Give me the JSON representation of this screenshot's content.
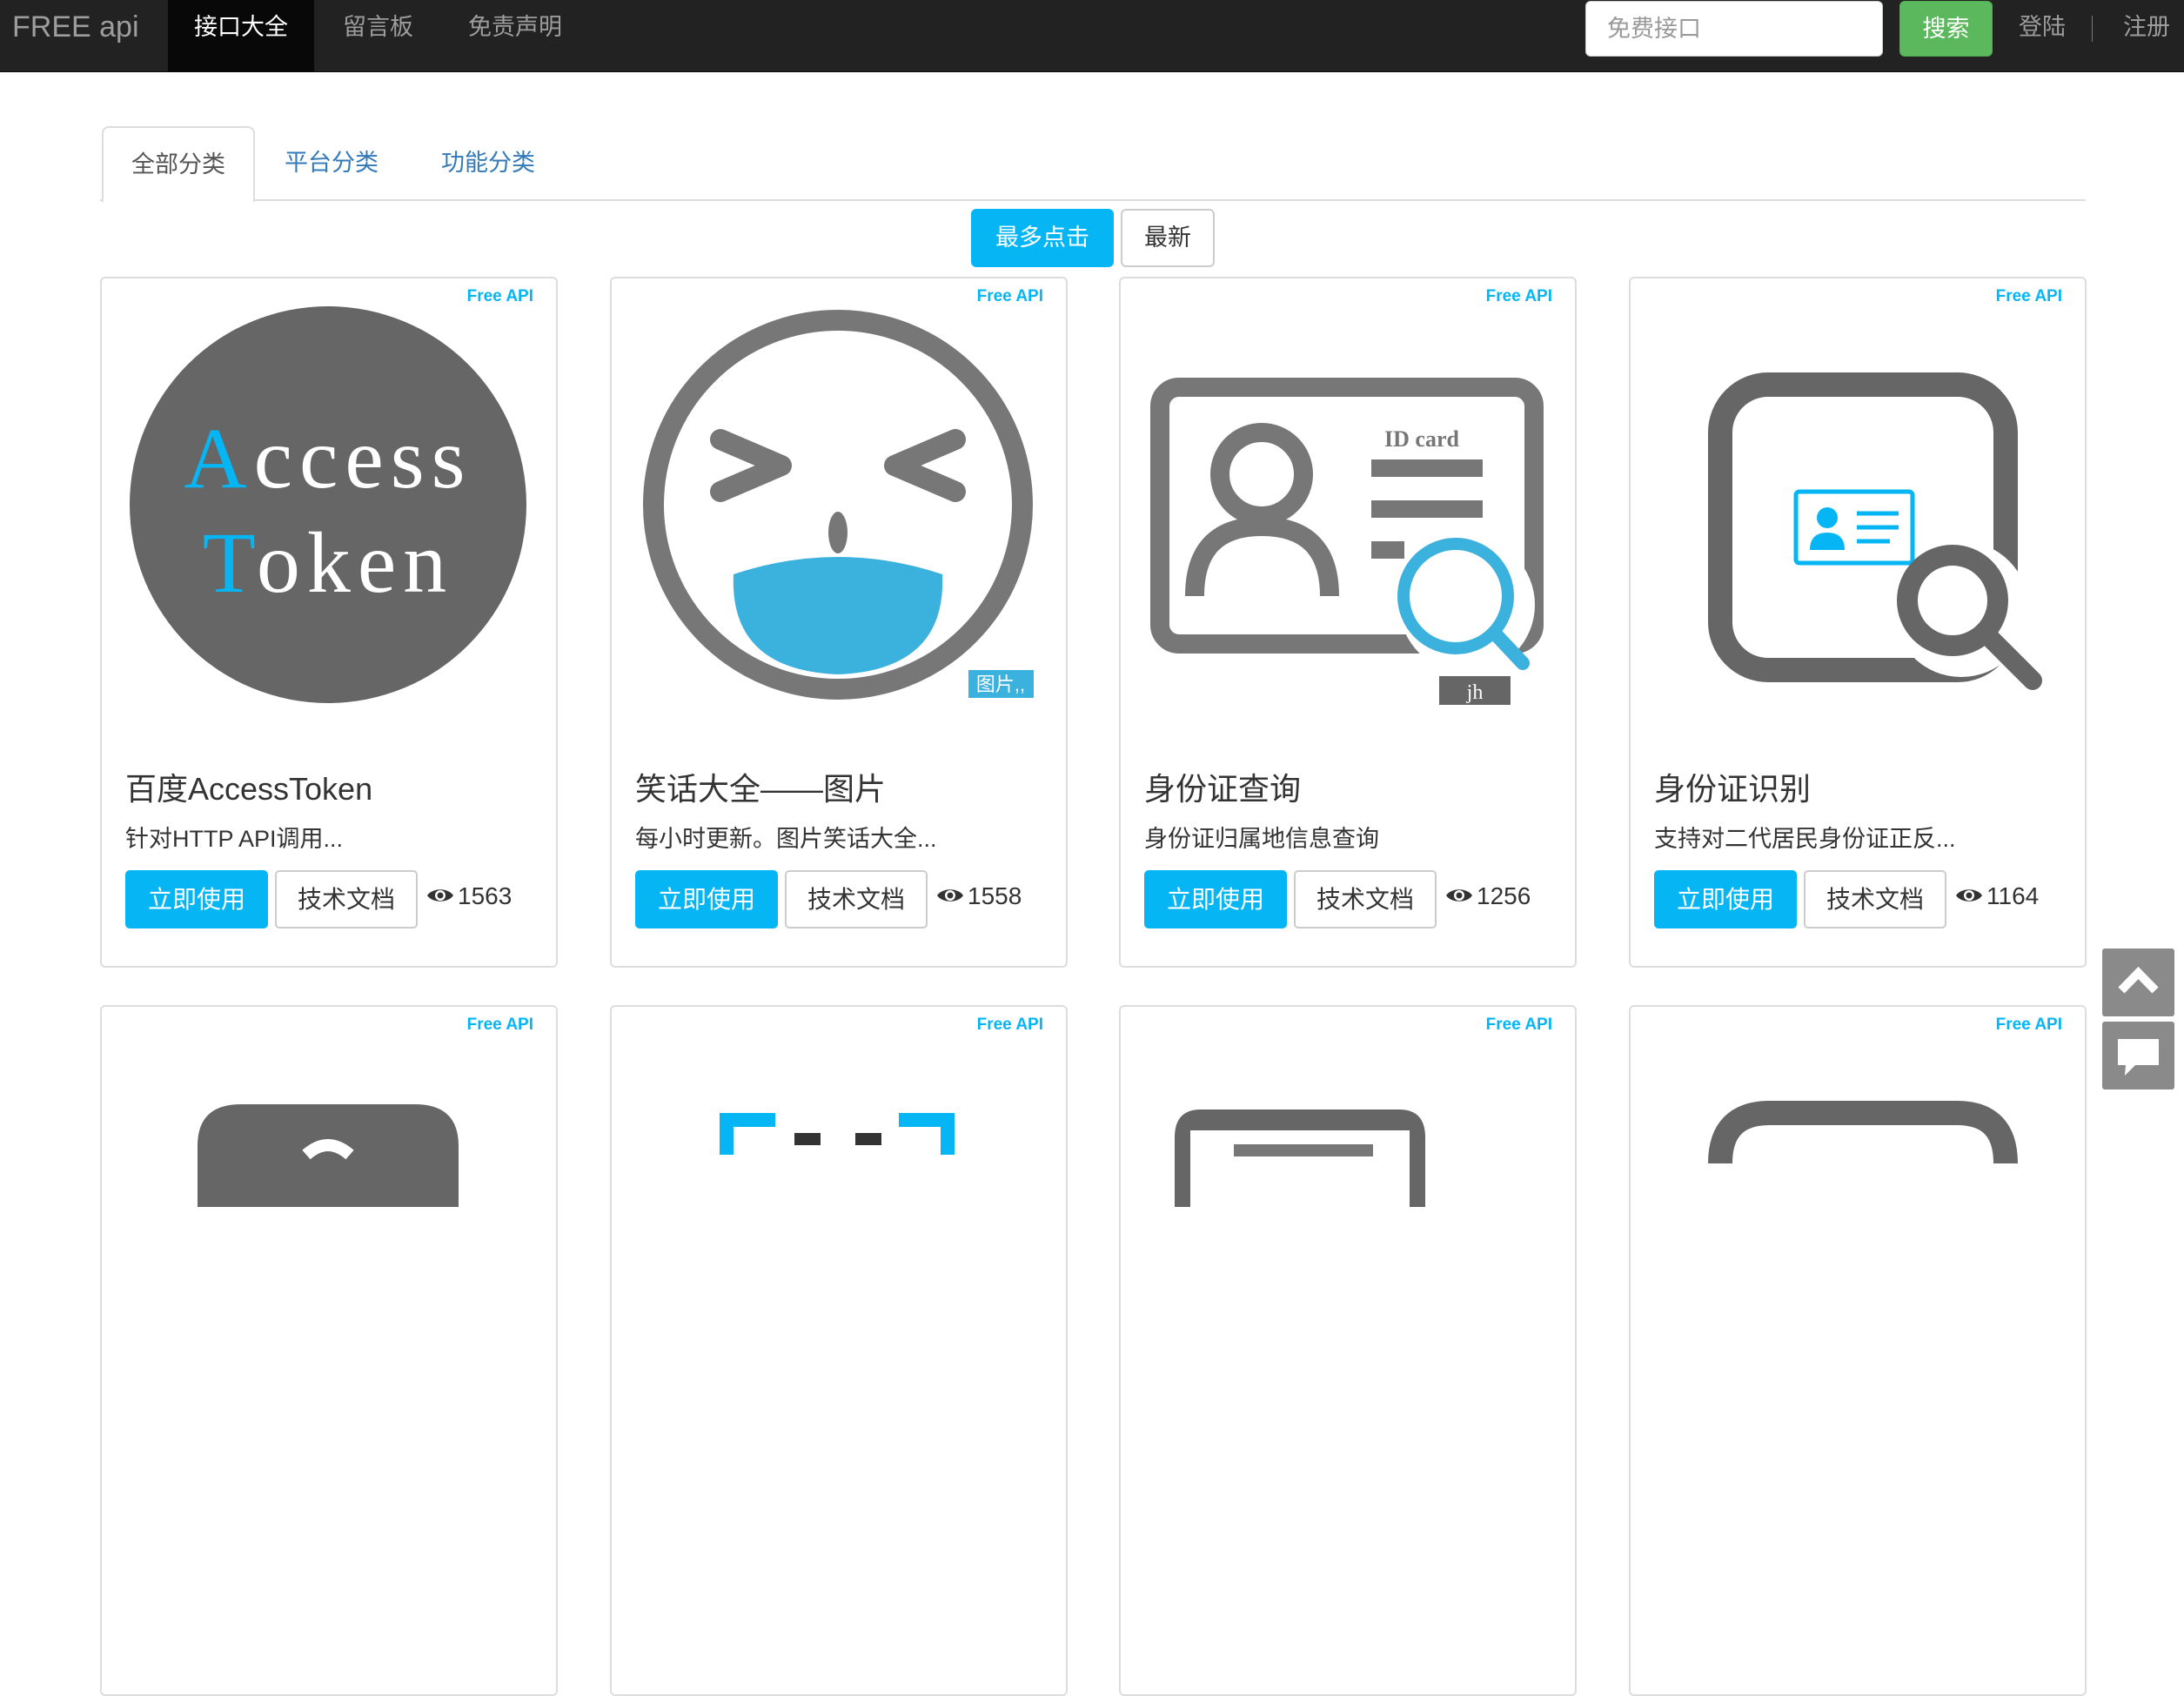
{
  "navbar": {
    "brand": "FREE api",
    "items": [
      {
        "label": "接口大全",
        "active": true
      },
      {
        "label": "留言板",
        "active": false
      },
      {
        "label": "免责声明",
        "active": false
      }
    ],
    "search": {
      "placeholder": "免费接口",
      "value": "",
      "button_label": "搜索"
    },
    "login_label": "登陆",
    "register_label": "注册"
  },
  "tabs": [
    {
      "label": "全部分类",
      "active": true
    },
    {
      "label": "平台分类",
      "active": false
    },
    {
      "label": "功能分类",
      "active": false
    }
  ],
  "sort": {
    "most_clicks_label": "最多点击",
    "newest_label": "最新",
    "active": "most_clicks"
  },
  "cards": [
    {
      "tag": "Free API",
      "title": "百度AccessToken",
      "description": "针对HTTP API调用...",
      "use_label": "立即使用",
      "doc_label": "技术文档",
      "views": "1563",
      "image_icon": "access-token-icon",
      "image_text_line1_first": "A",
      "image_text_line1_rest": "ccess",
      "image_text_line2_first": "T",
      "image_text_line2_rest": "oken"
    },
    {
      "tag": "Free API",
      "title": "笑话大全——图片",
      "description": "每小时更新。图片笑话大全...",
      "use_label": "立即使用",
      "doc_label": "技术文档",
      "views": "1558",
      "image_icon": "laughing-face-icon",
      "image_badge": "图片,,"
    },
    {
      "tag": "Free API",
      "title": "身份证查询",
      "description": "身份证归属地信息查询",
      "use_label": "立即使用",
      "doc_label": "技术文档",
      "views": "1256",
      "image_icon": "id-card-search-icon",
      "image_card_label": "ID card",
      "image_badge": "jh"
    },
    {
      "tag": "Free API",
      "title": "身份证识别",
      "description": "支持对二代居民身份证正反...",
      "use_label": "立即使用",
      "doc_label": "技术文档",
      "views": "1164",
      "image_icon": "id-recognition-icon"
    },
    {
      "tag": "Free API",
      "image_icon": "partial-icon"
    },
    {
      "tag": "Free API",
      "image_icon": "partial-icon"
    },
    {
      "tag": "Free API",
      "image_icon": "partial-icon"
    },
    {
      "tag": "Free API",
      "image_icon": "partial-icon"
    }
  ],
  "side_tools": [
    {
      "icon": "chevron-up-icon"
    },
    {
      "icon": "comment-icon"
    }
  ],
  "colors": {
    "navbar_bg": "#222222",
    "accent": "#06b6f4",
    "search_button": "#5cb85c",
    "icon_gray": "#777777"
  }
}
